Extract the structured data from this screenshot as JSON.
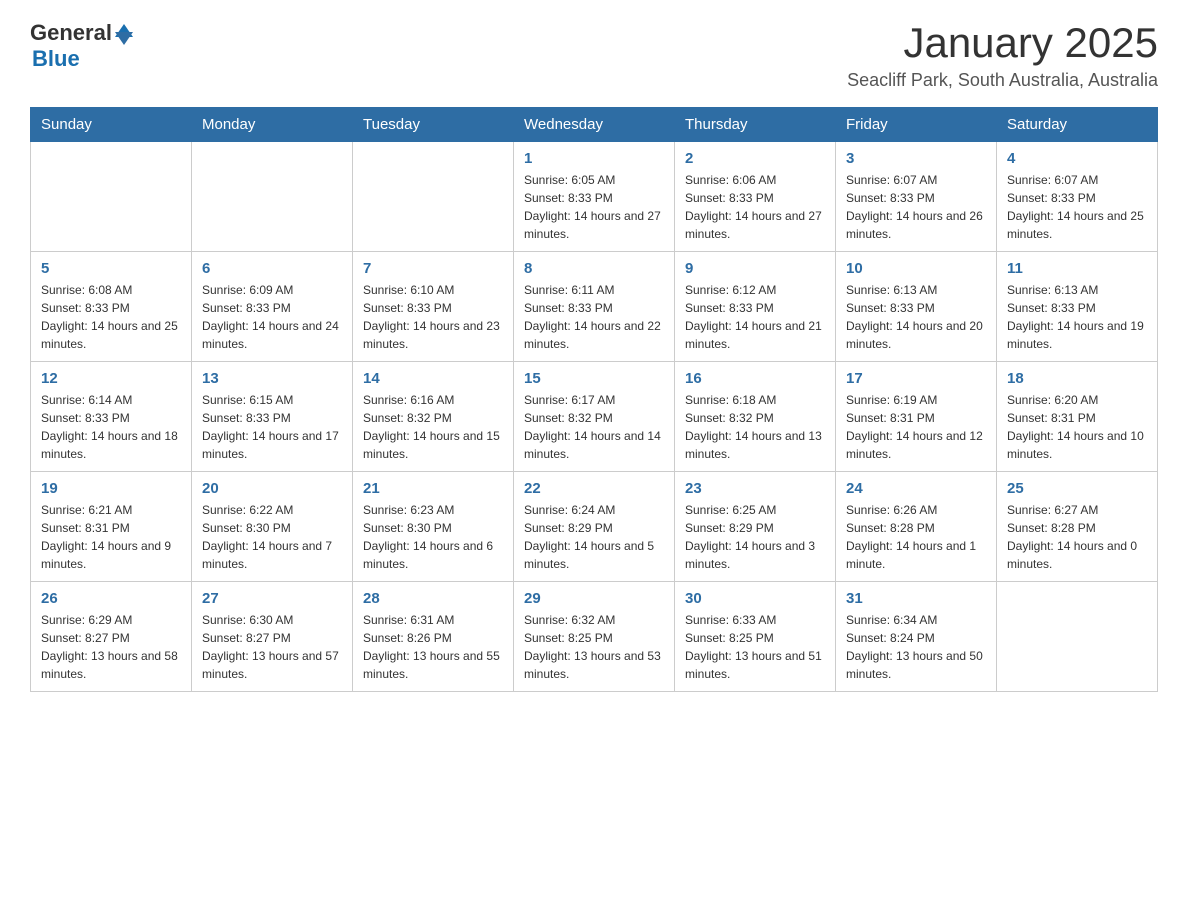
{
  "header": {
    "logo_general": "General",
    "logo_blue": "Blue",
    "title": "January 2025",
    "location": "Seacliff Park, South Australia, Australia"
  },
  "days_of_week": [
    "Sunday",
    "Monday",
    "Tuesday",
    "Wednesday",
    "Thursday",
    "Friday",
    "Saturday"
  ],
  "weeks": [
    [
      {
        "day": "",
        "info": ""
      },
      {
        "day": "",
        "info": ""
      },
      {
        "day": "",
        "info": ""
      },
      {
        "day": "1",
        "info": "Sunrise: 6:05 AM\nSunset: 8:33 PM\nDaylight: 14 hours and 27 minutes."
      },
      {
        "day": "2",
        "info": "Sunrise: 6:06 AM\nSunset: 8:33 PM\nDaylight: 14 hours and 27 minutes."
      },
      {
        "day": "3",
        "info": "Sunrise: 6:07 AM\nSunset: 8:33 PM\nDaylight: 14 hours and 26 minutes."
      },
      {
        "day": "4",
        "info": "Sunrise: 6:07 AM\nSunset: 8:33 PM\nDaylight: 14 hours and 25 minutes."
      }
    ],
    [
      {
        "day": "5",
        "info": "Sunrise: 6:08 AM\nSunset: 8:33 PM\nDaylight: 14 hours and 25 minutes."
      },
      {
        "day": "6",
        "info": "Sunrise: 6:09 AM\nSunset: 8:33 PM\nDaylight: 14 hours and 24 minutes."
      },
      {
        "day": "7",
        "info": "Sunrise: 6:10 AM\nSunset: 8:33 PM\nDaylight: 14 hours and 23 minutes."
      },
      {
        "day": "8",
        "info": "Sunrise: 6:11 AM\nSunset: 8:33 PM\nDaylight: 14 hours and 22 minutes."
      },
      {
        "day": "9",
        "info": "Sunrise: 6:12 AM\nSunset: 8:33 PM\nDaylight: 14 hours and 21 minutes."
      },
      {
        "day": "10",
        "info": "Sunrise: 6:13 AM\nSunset: 8:33 PM\nDaylight: 14 hours and 20 minutes."
      },
      {
        "day": "11",
        "info": "Sunrise: 6:13 AM\nSunset: 8:33 PM\nDaylight: 14 hours and 19 minutes."
      }
    ],
    [
      {
        "day": "12",
        "info": "Sunrise: 6:14 AM\nSunset: 8:33 PM\nDaylight: 14 hours and 18 minutes."
      },
      {
        "day": "13",
        "info": "Sunrise: 6:15 AM\nSunset: 8:33 PM\nDaylight: 14 hours and 17 minutes."
      },
      {
        "day": "14",
        "info": "Sunrise: 6:16 AM\nSunset: 8:32 PM\nDaylight: 14 hours and 15 minutes."
      },
      {
        "day": "15",
        "info": "Sunrise: 6:17 AM\nSunset: 8:32 PM\nDaylight: 14 hours and 14 minutes."
      },
      {
        "day": "16",
        "info": "Sunrise: 6:18 AM\nSunset: 8:32 PM\nDaylight: 14 hours and 13 minutes."
      },
      {
        "day": "17",
        "info": "Sunrise: 6:19 AM\nSunset: 8:31 PM\nDaylight: 14 hours and 12 minutes."
      },
      {
        "day": "18",
        "info": "Sunrise: 6:20 AM\nSunset: 8:31 PM\nDaylight: 14 hours and 10 minutes."
      }
    ],
    [
      {
        "day": "19",
        "info": "Sunrise: 6:21 AM\nSunset: 8:31 PM\nDaylight: 14 hours and 9 minutes."
      },
      {
        "day": "20",
        "info": "Sunrise: 6:22 AM\nSunset: 8:30 PM\nDaylight: 14 hours and 7 minutes."
      },
      {
        "day": "21",
        "info": "Sunrise: 6:23 AM\nSunset: 8:30 PM\nDaylight: 14 hours and 6 minutes."
      },
      {
        "day": "22",
        "info": "Sunrise: 6:24 AM\nSunset: 8:29 PM\nDaylight: 14 hours and 5 minutes."
      },
      {
        "day": "23",
        "info": "Sunrise: 6:25 AM\nSunset: 8:29 PM\nDaylight: 14 hours and 3 minutes."
      },
      {
        "day": "24",
        "info": "Sunrise: 6:26 AM\nSunset: 8:28 PM\nDaylight: 14 hours and 1 minute."
      },
      {
        "day": "25",
        "info": "Sunrise: 6:27 AM\nSunset: 8:28 PM\nDaylight: 14 hours and 0 minutes."
      }
    ],
    [
      {
        "day": "26",
        "info": "Sunrise: 6:29 AM\nSunset: 8:27 PM\nDaylight: 13 hours and 58 minutes."
      },
      {
        "day": "27",
        "info": "Sunrise: 6:30 AM\nSunset: 8:27 PM\nDaylight: 13 hours and 57 minutes."
      },
      {
        "day": "28",
        "info": "Sunrise: 6:31 AM\nSunset: 8:26 PM\nDaylight: 13 hours and 55 minutes."
      },
      {
        "day": "29",
        "info": "Sunrise: 6:32 AM\nSunset: 8:25 PM\nDaylight: 13 hours and 53 minutes."
      },
      {
        "day": "30",
        "info": "Sunrise: 6:33 AM\nSunset: 8:25 PM\nDaylight: 13 hours and 51 minutes."
      },
      {
        "day": "31",
        "info": "Sunrise: 6:34 AM\nSunset: 8:24 PM\nDaylight: 13 hours and 50 minutes."
      },
      {
        "day": "",
        "info": ""
      }
    ]
  ]
}
